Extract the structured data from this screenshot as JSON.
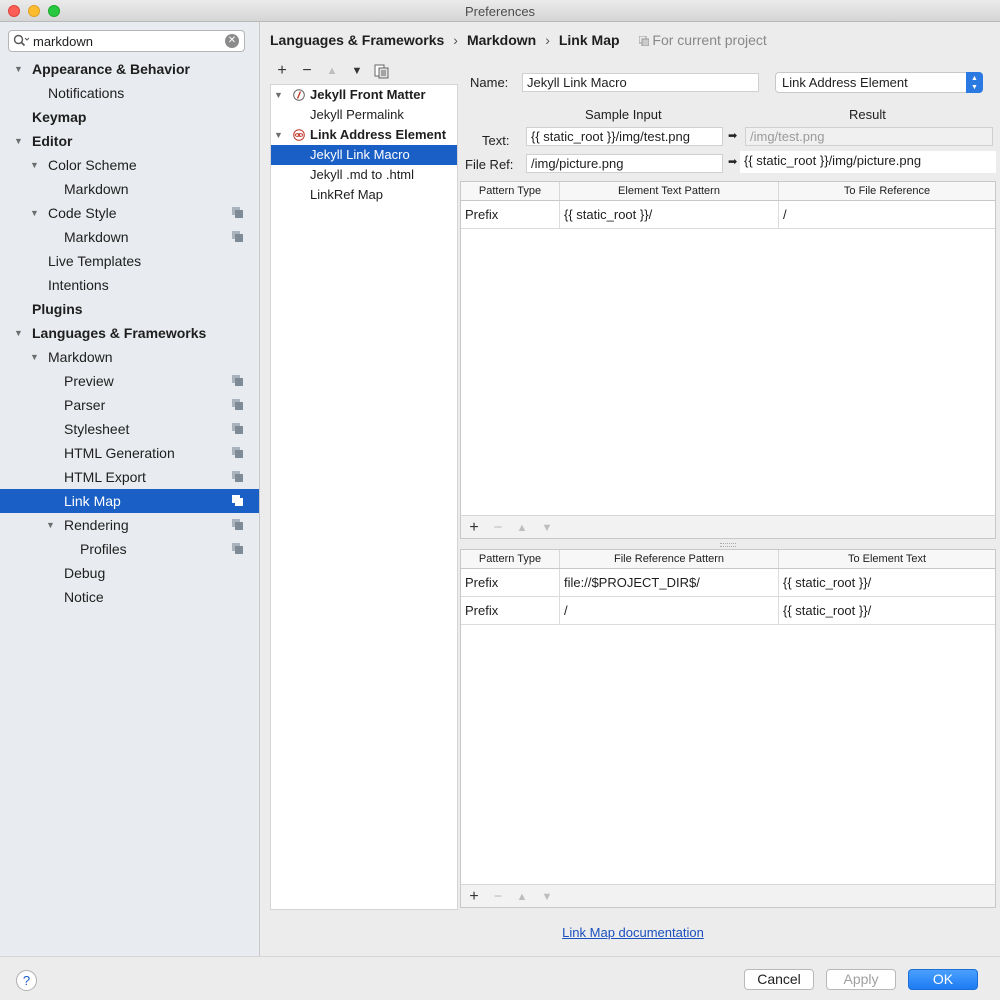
{
  "window": {
    "title": "Preferences"
  },
  "search": {
    "value": "markdown"
  },
  "sidebar": {
    "items": [
      {
        "label": "Appearance & Behavior"
      },
      {
        "label": "Notifications"
      },
      {
        "label": "Keymap"
      },
      {
        "label": "Editor"
      },
      {
        "label": "Color Scheme"
      },
      {
        "label": "Markdown"
      },
      {
        "label": "Code Style"
      },
      {
        "label": "Markdown"
      },
      {
        "label": "Live Templates"
      },
      {
        "label": "Intentions"
      },
      {
        "label": "Plugins"
      },
      {
        "label": "Languages & Frameworks"
      },
      {
        "label": "Markdown"
      },
      {
        "label": "Preview"
      },
      {
        "label": "Parser"
      },
      {
        "label": "Stylesheet"
      },
      {
        "label": "HTML Generation"
      },
      {
        "label": "HTML Export"
      },
      {
        "label": "Link Map"
      },
      {
        "label": "Rendering"
      },
      {
        "label": "Profiles"
      },
      {
        "label": "Debug"
      },
      {
        "label": "Notice"
      }
    ]
  },
  "breadcrumb": {
    "items": [
      "Languages & Frameworks",
      "Markdown",
      "Link Map"
    ],
    "scope": "For current project"
  },
  "elements": {
    "items": [
      {
        "label": "Jekyll Front Matter"
      },
      {
        "label": "Jekyll Permalink"
      },
      {
        "label": "Link Address Element"
      },
      {
        "label": "Jekyll Link Macro"
      },
      {
        "label": "Jekyll .md to .html"
      },
      {
        "label": "LinkRef Map"
      }
    ]
  },
  "detail": {
    "name_label": "Name:",
    "name_value": "Jekyll Link Macro",
    "type_value": "Link Address Element",
    "sample_input_header": "Sample Input",
    "result_header": "Result",
    "text_label": "Text:",
    "text_value": "{{ static_root }}/img/test.png",
    "text_result": "/img/test.png",
    "fileref_label": "File Ref:",
    "fileref_value": "/img/picture.png",
    "fileref_result": "{{ static_root }}/img/picture.png"
  },
  "table_top": {
    "columns": [
      "Pattern Type",
      "Element Text Pattern",
      "To File Reference"
    ],
    "rows": [
      [
        "Prefix",
        "{{ static_root }}/",
        "/"
      ]
    ]
  },
  "table_bottom": {
    "columns": [
      "Pattern Type",
      "File Reference Pattern",
      "To Element Text"
    ],
    "rows": [
      [
        "Prefix",
        "file://$PROJECT_DIR$/",
        "{{ static_root }}/"
      ],
      [
        "Prefix",
        "/",
        "{{ static_root }}/"
      ]
    ]
  },
  "toolbar_glyphs": {
    "add": "+",
    "remove": "−",
    "up": "▲",
    "down": "▼"
  },
  "doc_link": "Link Map documentation",
  "buttons": {
    "help": "?",
    "cancel": "Cancel",
    "apply": "Apply",
    "ok": "OK"
  },
  "colors": {
    "selection": "#1a5fc5",
    "primary": "#1d7cf2",
    "link": "#1a4fbf"
  }
}
